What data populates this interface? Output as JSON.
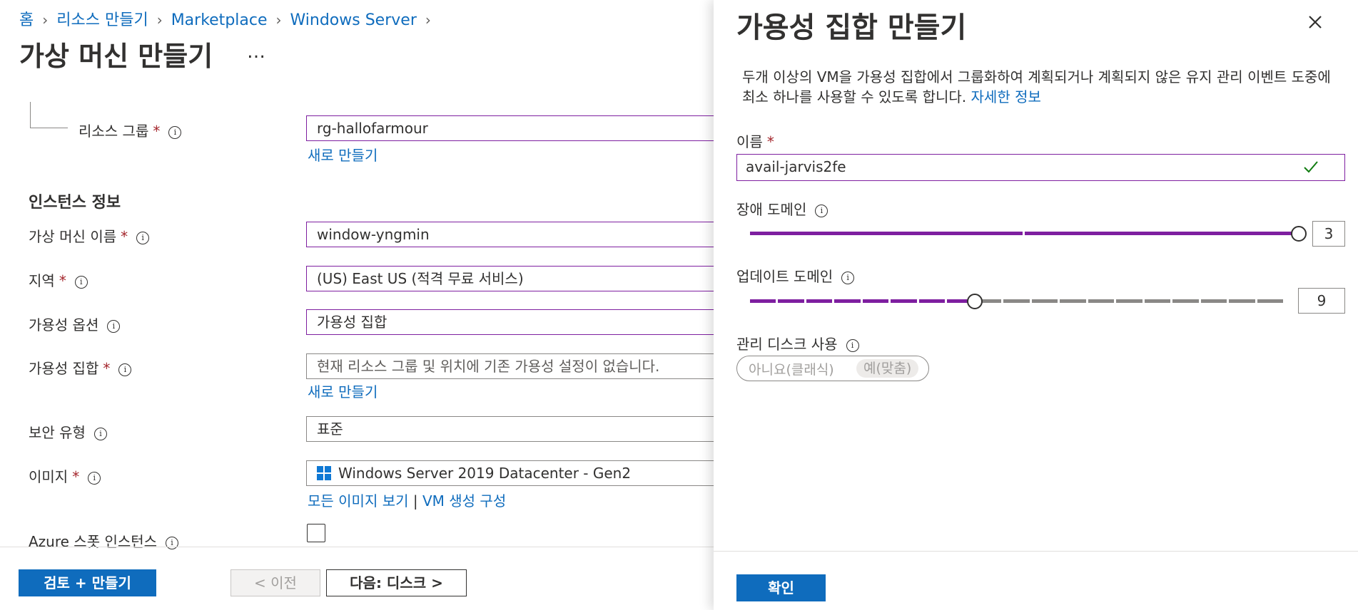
{
  "breadcrumb": {
    "items": [
      "홈",
      "리소스 만들기",
      "Marketplace",
      "Windows Server"
    ]
  },
  "page": {
    "title": "가상 머신 만들기",
    "more": "…"
  },
  "form": {
    "resource_group": {
      "label": "리소스 그룹",
      "required": "*",
      "value": "rg-hallofarmour",
      "create_new": "새로 만들기"
    },
    "instance_section": "인스턴스 정보",
    "vm_name": {
      "label": "가상 머신 이름",
      "required": "*",
      "value": "window-yngmin"
    },
    "region": {
      "label": "지역",
      "required": "*",
      "value": "(US) East US (적격 무료 서비스)"
    },
    "availability_options": {
      "label": "가용성 옵션",
      "value": "가용성 집합"
    },
    "availability_set": {
      "label": "가용성 집합",
      "required": "*",
      "placeholder": "현재 리소스 그룹 및 위치에 기존 가용성 설정이 없습니다.",
      "create_new": "새로 만들기"
    },
    "security_type": {
      "label": "보안 유형",
      "value": "표준"
    },
    "image": {
      "label": "이미지",
      "required": "*",
      "value": "Windows Server 2019 Datacenter - Gen2",
      "see_all": "모든 이미지 보기",
      "separator": "|",
      "configure_vm": "VM 생성 구성"
    },
    "spot": {
      "label": "Azure 스폿 인스턴스",
      "checked": false
    }
  },
  "footer": {
    "review_create": "검토 + 만들기",
    "previous": "< 이전",
    "next": "다음: 디스크 >"
  },
  "panel": {
    "title": "가용성 집합 만들기",
    "description": "두개 이상의 VM을 가용성 집합에서 그룹화하여 계획되거나 계획되지 않은 유지 관리 이벤트 도중에 최소 하나를 사용할 수 있도록 합니다.",
    "learn_more": "자세한 정보",
    "name": {
      "label": "이름",
      "required": "*",
      "value": "avail-jarvis2fe"
    },
    "fault_domains": {
      "label": "장애 도메인",
      "value": "3",
      "min": 1,
      "max": 3
    },
    "update_domains": {
      "label": "업데이트 도메인",
      "value": "9",
      "min": 1,
      "max": 20
    },
    "managed_disks": {
      "label": "관리 디스크 사용",
      "option_no": "아니요(클래식)",
      "option_yes": "예(맞춤)",
      "selected": "option_yes"
    },
    "ok": "확인"
  },
  "colors": {
    "accent": "#0f6cbd",
    "slider_fill": "#7e1fa0",
    "slider_empty": "#8a8886",
    "required": "#a4262c",
    "valid_check": "#107c10"
  }
}
